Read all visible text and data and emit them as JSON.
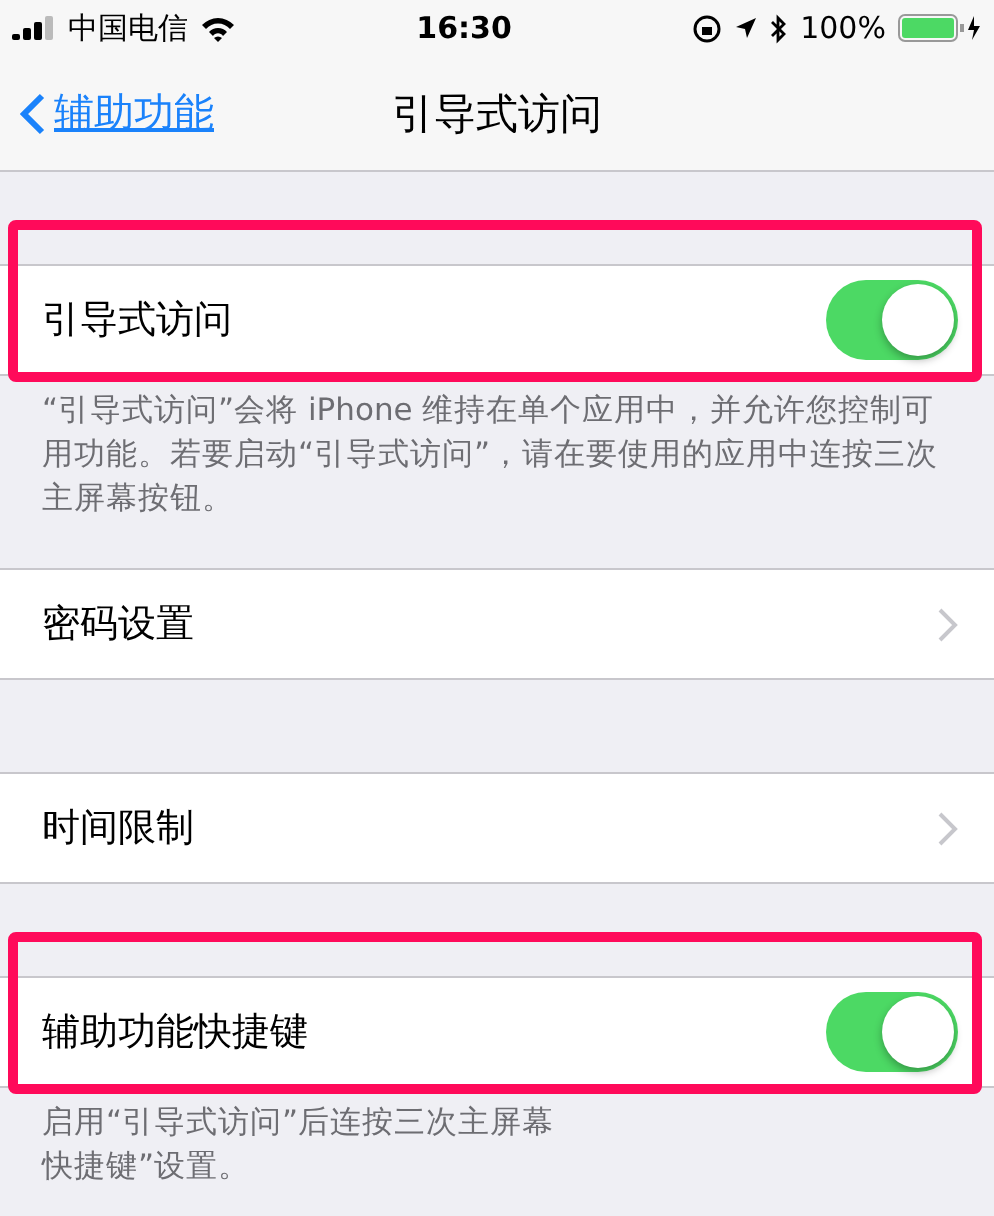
{
  "status_bar": {
    "carrier": "中国电信",
    "time": "16:30",
    "battery": "100%"
  },
  "nav": {
    "back": "辅助功能",
    "title": "引导式访问"
  },
  "sections": [
    {
      "row": {
        "kind": "toggle",
        "label": "引导式访问",
        "on": true
      },
      "highlighted": true,
      "footer": [
        "“引导式访问”会将 iPhone 维持在单个应用中，并允许您控制可用功能。若要启动“引导式访问”，请在要使用的应用中连按三次主屏幕按钮。"
      ]
    },
    {
      "row": {
        "kind": "disclosure",
        "label": "密码设置"
      },
      "highlighted": false
    },
    {
      "row": {
        "kind": "disclosure",
        "label": "时间限制"
      },
      "highlighted": false
    },
    {
      "row": {
        "kind": "toggle",
        "label": "辅助功能快捷键",
        "on": true
      },
      "highlighted": true,
      "footer": [
        "启用“引导式访问”后连按三次主屏幕",
        "快捷键”设置。"
      ]
    }
  ]
}
